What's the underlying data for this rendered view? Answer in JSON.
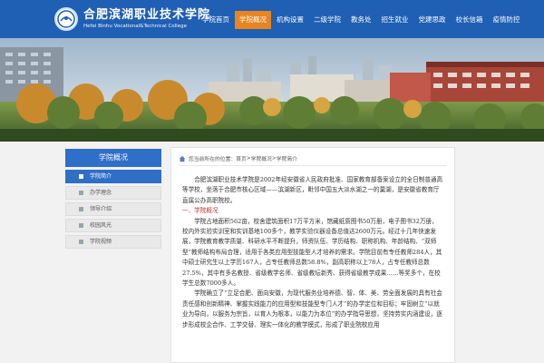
{
  "header": {
    "logo_cn": "合肥滨湖职业技术学院",
    "logo_en": "Hefei Binhu Vocational&Technical College",
    "nav": [
      {
        "label": "学院首页",
        "active": false
      },
      {
        "label": "学院概况",
        "active": true
      },
      {
        "label": "机构设置",
        "active": false
      },
      {
        "label": "二级学院",
        "active": false
      },
      {
        "label": "教务处",
        "active": false
      },
      {
        "label": "招生就业",
        "active": false
      },
      {
        "label": "党建思政",
        "active": false
      },
      {
        "label": "校长信箱",
        "active": false
      },
      {
        "label": "疫情防控",
        "active": false
      }
    ]
  },
  "sidebar": {
    "title": "学院概况",
    "items": [
      {
        "label": "学院简介",
        "active": true
      },
      {
        "label": "办学理念",
        "active": false
      },
      {
        "label": "领导介绍",
        "active": false
      },
      {
        "label": "校园风光",
        "active": false
      },
      {
        "label": "学院视频",
        "active": false
      }
    ]
  },
  "breadcrumb": {
    "prefix": "您当前所在的位置：",
    "home": "首页",
    "sep1": " > ",
    "section": "学院概况",
    "sep2": " > ",
    "page": "学院简介"
  },
  "article": {
    "p1": "合肥滨湖职业技术学院是2002年经安徽省人民政府批准、国家教育部备案设立的全日制普通高等学校，坐落于合肥市核心区域——滨湖新区，毗邻中国五大淡水湖之一的巢湖，是安徽省教育厅直属公办高职院校。",
    "sec1": "一、学院概况",
    "p2": "学院占地面积562亩，校舍建筑面积17万平方米，馆藏纸质图书50万册，电子图书32万册，校内外实验实训室和实训基地100多个，教学实验仪器设备总值达2600万元。经过十几年快速发展，学院教育教学质量、科研水平不断提升，师资队伍、学历结构、职称机构、年龄结构、“双师型”教师结构布局合理，适用于各类应用型技能型人才培养的需求。学院目前有专任教师284人，其中硕士研究生以上学历167人，占专任教师总数58.8%，副高职称以上78人，占专任教师总数27.5%，其中有多名教授、省级教学名师、省级教坛新秀、获得省级教学成果……等奖多个，在校学生总数7000多人。",
    "p3": "学院确立了“立足合肥、面向安徽，为现代服务业培养德、智、体、美、劳全面发展的具有社会责任感和创新精神、掌握实践能力的应用型和技能型专门人才”的办学定位和目标；牢固树立“以就业为导向，以服务为宗旨，以育人为根本，以能力为本位”的办学指导思想，坚持劳实内涵建设，逐步形成校企合作、工学交替、理实一体化的教学模式，形成了职业院校应用"
  }
}
